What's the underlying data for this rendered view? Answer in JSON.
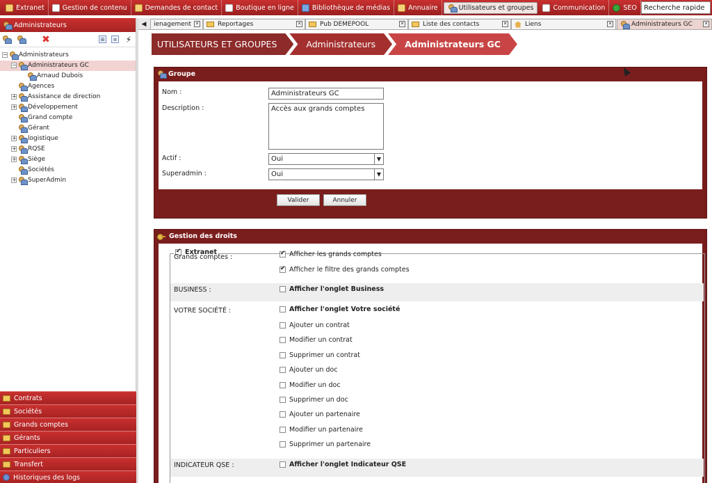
{
  "topnav": {
    "items": [
      {
        "label": "Extranet",
        "icon": "house-icon"
      },
      {
        "label": "Gestion de contenu",
        "icon": "document-icon"
      },
      {
        "label": "Demandes de contact",
        "icon": "folder-icon"
      },
      {
        "label": "Boutique en ligne",
        "icon": "cart-icon"
      },
      {
        "label": "Bibliothèque de médias",
        "icon": "media-icon"
      },
      {
        "label": "Annuaire",
        "icon": "house-icon"
      },
      {
        "label": "Utilisateurs et groupes",
        "icon": "users-icon"
      },
      {
        "label": "Communication",
        "icon": "mail-icon"
      },
      {
        "label": "SEO",
        "icon": "globe-icon"
      }
    ],
    "active": "Utilisateurs et groupes",
    "search_value": "Recherche rapide"
  },
  "sidebar": {
    "title": "Administrateurs",
    "tree": [
      {
        "label": "Administrateurs",
        "level": 0,
        "toggle": "-",
        "selected": false
      },
      {
        "label": "Administrateurs GC",
        "level": 1,
        "toggle": "-",
        "selected": true
      },
      {
        "label": "Arnaud Dubois",
        "level": 2,
        "toggle": "",
        "selected": false
      },
      {
        "label": "Agences",
        "level": 1,
        "toggle": "",
        "selected": false
      },
      {
        "label": "Assistance de direction",
        "level": 1,
        "toggle": "+",
        "selected": false
      },
      {
        "label": "Développement",
        "level": 1,
        "toggle": "+",
        "selected": false
      },
      {
        "label": "Grand compte",
        "level": 1,
        "toggle": "",
        "selected": false
      },
      {
        "label": "Gérant",
        "level": 1,
        "toggle": "",
        "selected": false
      },
      {
        "label": "logistique",
        "level": 1,
        "toggle": "+",
        "selected": false
      },
      {
        "label": "RQSE",
        "level": 1,
        "toggle": "+",
        "selected": false
      },
      {
        "label": "Siège",
        "level": 1,
        "toggle": "+",
        "selected": false
      },
      {
        "label": "Sociétés",
        "level": 1,
        "toggle": "",
        "selected": false
      },
      {
        "label": "SuperAdmin",
        "level": 1,
        "toggle": "+",
        "selected": false
      }
    ],
    "accordion": [
      "Contrats",
      "Sociétés",
      "Grands comptes",
      "Gérants",
      "Particuliers",
      "Transfert",
      "Historiques des logs"
    ]
  },
  "tabs": [
    {
      "label": "ienagement",
      "icon": "none"
    },
    {
      "label": "Reportages",
      "icon": "folder-icon"
    },
    {
      "label": "Pub DEMEPOOL",
      "icon": "folder-icon"
    },
    {
      "label": "Liste des contacts",
      "icon": "folder-icon"
    },
    {
      "label": "Liens",
      "icon": "house-icon"
    },
    {
      "label": "Administrateurs GC",
      "icon": "users-icon"
    }
  ],
  "breadcrumb": [
    "UTILISATEURS ET GROUPES",
    "Administrateurs",
    "Administrateurs GC"
  ],
  "groupe": {
    "title": "Groupe",
    "nom_label": "Nom :",
    "nom_value": "Administrateurs GC",
    "description_label": "Description :",
    "description_value": "Accès aux grands comptes",
    "actif_label": "Actif :",
    "actif_value": "Oui",
    "superadmin_label": "Superadmin :",
    "superadmin_value": "Oui",
    "valider": "Valider",
    "annuler": "Annuler"
  },
  "droits": {
    "title": "Gestion des droits",
    "legend": "Extranet",
    "legend_checked": true,
    "sections": [
      {
        "label": "Grands comptes :",
        "options": [
          {
            "label": "Afficher les grands comptes",
            "checked": true,
            "bold": false
          },
          {
            "label": "Afficher le filtre des grands comptes",
            "checked": true,
            "bold": false
          }
        ]
      },
      {
        "label": "BUSINESS :",
        "options": [
          {
            "label": "Afficher l'onglet Business",
            "checked": false,
            "bold": true
          }
        ]
      },
      {
        "label": "VOTRE SOCIÉTÉ :",
        "options": [
          {
            "label": "Afficher l'onglet Votre société",
            "checked": false,
            "bold": true
          },
          {
            "label": "Ajouter un contrat",
            "checked": false,
            "bold": false
          },
          {
            "label": "Modifier un contrat",
            "checked": false,
            "bold": false
          },
          {
            "label": "Supprimer un contrat",
            "checked": false,
            "bold": false
          },
          {
            "label": "Ajouter un doc",
            "checked": false,
            "bold": false
          },
          {
            "label": "Modifier un doc",
            "checked": false,
            "bold": false
          },
          {
            "label": "Supprimer un doc",
            "checked": false,
            "bold": false
          },
          {
            "label": "Ajouter un partenaire",
            "checked": false,
            "bold": false
          },
          {
            "label": "Modifier un partenaire",
            "checked": false,
            "bold": false
          },
          {
            "label": "Supprimer un partenaire",
            "checked": false,
            "bold": false
          }
        ]
      },
      {
        "label": "INDICATEUR QSE :",
        "options": [
          {
            "label": "Afficher l'onglet Indicateur QSE",
            "checked": false,
            "bold": true
          }
        ]
      }
    ]
  },
  "colors": {
    "accent": "#b92a2a",
    "panel": "#7a1d1d",
    "selected": "#f1d3d2"
  }
}
